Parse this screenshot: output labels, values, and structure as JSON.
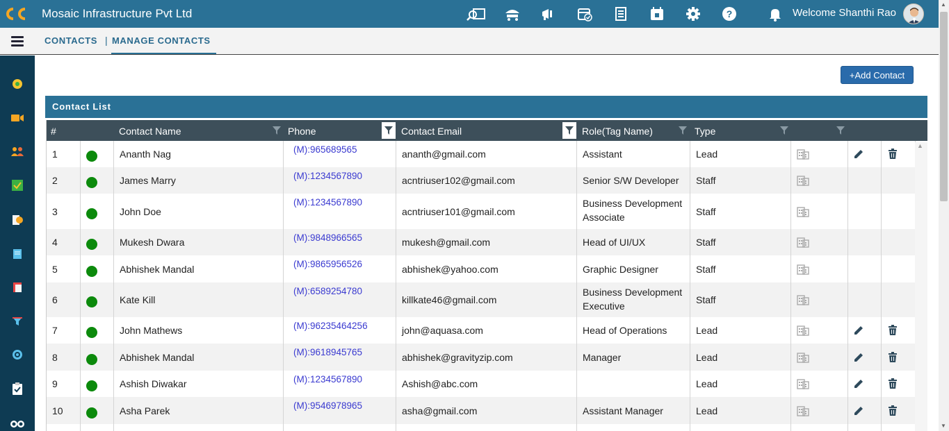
{
  "app": {
    "title": "Mosaic Infrastructure Pvt Ltd",
    "welcome": "Welcome Shanthi Rao"
  },
  "colors": {
    "primary": "#2a7196",
    "sidebar": "#0e3b53",
    "status_active": "#0c8a0c",
    "phone_link": "#3a3ad0"
  },
  "top_icons": [
    "search-report-icon",
    "travel-icon",
    "announcement-icon",
    "calendar-check-icon",
    "list-document-icon",
    "calendar-icon",
    "gear-icon",
    "help-icon",
    "bell-icon"
  ],
  "breadcrumb": {
    "section": "CONTACTS",
    "page": "MANAGE CONTACTS"
  },
  "sidebar_icons": [
    "dashboard-icon",
    "video-icon",
    "users-icon",
    "tasks-icon",
    "documents-icon",
    "notes-icon",
    "reports-icon",
    "funnel-icon",
    "target-icon",
    "clipboard-icon",
    "binoculars-icon"
  ],
  "actions": {
    "add_contact": "+Add Contact"
  },
  "panel": {
    "title": "Contact List"
  },
  "table": {
    "headers": [
      "#",
      "Contact Name",
      "Phone",
      "Contact Email",
      "Role(Tag Name)",
      "Type"
    ],
    "active_filters": [
      "Phone",
      "Contact Email"
    ],
    "rows": [
      {
        "num": "1",
        "name": "Ananth Nag",
        "phone": "(M):965689565",
        "email": "ananth@gmail.com",
        "role": "Assistant",
        "role2": "",
        "type": "Lead",
        "editable": true
      },
      {
        "num": "2",
        "name": "James Marry",
        "phone": "(M):1234567890",
        "email": "acntriuser102@gmail.com",
        "role": "Senior S/W Developer",
        "role2": "",
        "type": "Staff",
        "editable": false
      },
      {
        "num": "3",
        "name": "John Doe",
        "phone": "(M):1234567890",
        "email": "acntriuser101@gmail.com",
        "role": "Business Development",
        "role2": "Associate",
        "type": "Staff",
        "editable": false
      },
      {
        "num": "4",
        "name": "Mukesh Dwara",
        "phone": "(M):9848966565",
        "email": "mukesh@gmail.com",
        "role": "Head of UI/UX",
        "role2": "",
        "type": "Staff",
        "editable": false
      },
      {
        "num": "5",
        "name": "Abhishek Mandal",
        "phone": "(M):9865956526",
        "email": "abhishek@yahoo.com",
        "role": "Graphic Designer",
        "role2": "",
        "type": "Staff",
        "editable": false
      },
      {
        "num": "6",
        "name": "Kate Kill",
        "phone": "(M):6589254780",
        "email": "killkate46@gmail.com",
        "role": "Business Development",
        "role2": "Executive",
        "type": "Staff",
        "editable": false
      },
      {
        "num": "7",
        "name": "John Mathews",
        "phone": "(M):96235464256",
        "email": "john@aquasa.com",
        "role": "Head of Operations",
        "role2": "",
        "type": "Lead",
        "editable": true
      },
      {
        "num": "8",
        "name": "Abhishek Mandal",
        "phone": "(M):9618945765",
        "email": "abhishek@gravityzip.com",
        "role": "Manager",
        "role2": "",
        "type": "Lead",
        "editable": true
      },
      {
        "num": "9",
        "name": "Ashish Diwakar",
        "phone": "(M):1234567890",
        "email": "Ashish@abc.com",
        "role": "",
        "role2": "",
        "type": "Lead",
        "editable": true
      },
      {
        "num": "10",
        "name": "Asha Parek",
        "phone": "(M):9546978965",
        "email": "asha@gmail.com",
        "role": "Assistant Manager",
        "role2": "",
        "type": "Lead",
        "editable": true
      }
    ]
  }
}
